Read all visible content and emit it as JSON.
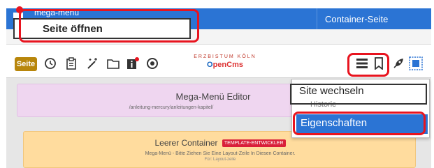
{
  "top": {
    "blue_row_left_text": "mega-menu",
    "blue_row_right_text": "Container-Seite",
    "context_popup_label": "Seite öffnen"
  },
  "toolbar": {
    "seite_label": "Seite",
    "icons": [
      "history-icon",
      "clipboard-icon",
      "magic-wand-icon",
      "folder-icon",
      "info-icon",
      "target-icon",
      "hamburger-menu-icon",
      "bookmark-icon",
      "rocket-icon",
      "frame-icon"
    ],
    "logo_line1": "ERZBISTUM KÖLN",
    "logo_line2_o": "O",
    "logo_line2_rest": "penCms"
  },
  "content": {
    "purple_card_title": "Mega-Menü Editor",
    "purple_card_path": "/anleitung-mercury/anleitungen-kapitel/",
    "orange_card_title": "Leerer Container",
    "orange_card_badge": "TEMPLATE-ENTWICKLER",
    "orange_card_text": "Mega-Menü - Bitte Ziehen Sie Eine Layout-Zeile In Diesen Container.",
    "orange_card_subtext": "Für: Layout-zeile"
  },
  "dropdown": {
    "items": [
      "Site wechseln",
      "Historie",
      "Eigenschaften"
    ]
  },
  "colors": {
    "accent_blue": "#2b74d4",
    "highlight_red": "#e8141f",
    "seite_button": "#b8860b",
    "purple_card": "#efd6f0",
    "orange_card": "#ffdc9e"
  }
}
